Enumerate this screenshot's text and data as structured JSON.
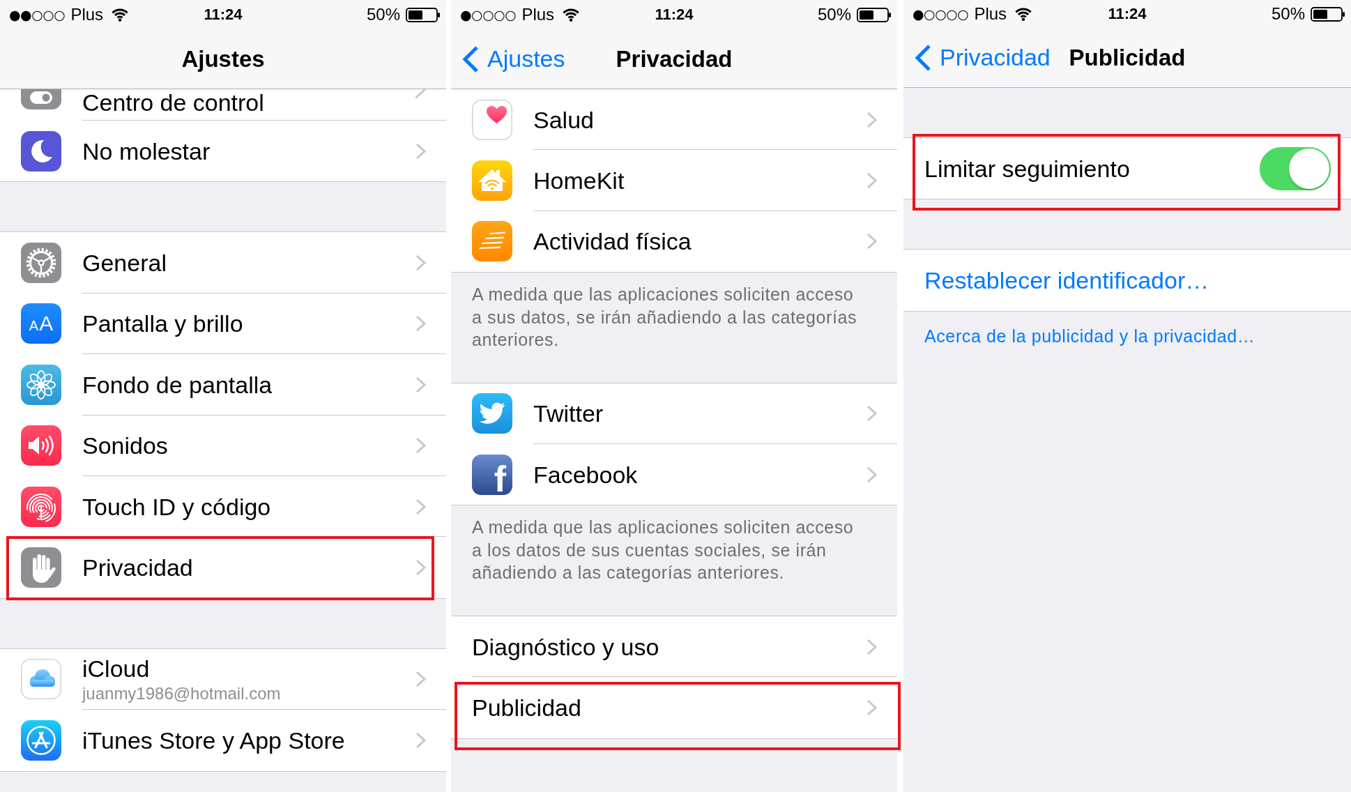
{
  "panels": [
    {
      "status_bar": {
        "signal": "●●○○○",
        "carrier": "Plus",
        "time": "11:24",
        "battery": "50%"
      },
      "nav_bar": {
        "title": "Ajustes"
      },
      "sections": [
        {
          "rows": [
            {
              "kind": "clipped",
              "label": "Centro de control",
              "highlighted": false
            },
            {
              "kind": "link",
              "label": "No molestar",
              "highlighted": false
            }
          ]
        },
        {
          "rows": [
            {
              "kind": "link",
              "label": "General",
              "highlighted": false
            },
            {
              "kind": "link",
              "label": "Pantalla y brillo",
              "icon_text": "AA",
              "highlighted": false
            },
            {
              "kind": "link",
              "label": "Fondo de pantalla",
              "highlighted": false
            },
            {
              "kind": "link",
              "label": "Sonidos",
              "highlighted": false
            },
            {
              "kind": "link",
              "label": "Touch ID y código",
              "highlighted": false
            },
            {
              "kind": "link",
              "label": "Privacidad",
              "highlighted": true
            }
          ]
        },
        {
          "rows": [
            {
              "kind": "link",
              "label": "iCloud",
              "subtitle": "juanmy1986@hotmail.com",
              "highlighted": false
            },
            {
              "kind": "link",
              "label": "iTunes Store y App Store",
              "highlighted": false
            }
          ]
        }
      ]
    },
    {
      "status_bar": {
        "signal": "●○○○○",
        "carrier": "Plus",
        "time": "11:24",
        "battery": "50%"
      },
      "nav_bar": {
        "back": "Ajustes",
        "title": "Privacidad"
      },
      "sections": [
        {
          "rows": [
            {
              "kind": "link",
              "label": "Salud",
              "highlighted": false
            },
            {
              "kind": "link",
              "label": "HomeKit",
              "highlighted": false
            },
            {
              "kind": "link",
              "label": "Actividad física",
              "highlighted": false
            }
          ],
          "footer": {
            "kind": "note",
            "text": "A medida que las aplicaciones soliciten acceso a sus datos, se irán añadiendo a las categorías anteriores."
          }
        },
        {
          "rows": [
            {
              "kind": "link",
              "label": "Twitter",
              "highlighted": false
            },
            {
              "kind": "link",
              "label": "Facebook",
              "icon_text": "f",
              "highlighted": false
            }
          ],
          "footer": {
            "kind": "note",
            "text": "A medida que las aplicaciones soliciten acceso a los datos de sus cuentas sociales, se irán añadiendo a las categorías anteriores."
          }
        },
        {
          "rows": [
            {
              "kind": "link",
              "label": "Diagnóstico y uso",
              "highlighted": false
            },
            {
              "kind": "link",
              "label": "Publicidad",
              "highlighted": true
            }
          ]
        }
      ]
    },
    {
      "status_bar": {
        "signal": "●○○○○",
        "carrier": "Plus",
        "time": "11:24",
        "battery": "50%"
      },
      "nav_bar": {
        "back": "Privacidad",
        "title": "Publicidad"
      },
      "sections": [
        {
          "rows": [
            {
              "kind": "toggle",
              "label": "Limitar seguimiento",
              "on": true,
              "highlighted": true
            }
          ]
        },
        {
          "rows": [
            {
              "kind": "action",
              "label": "Restablecer identificador…",
              "highlighted": false
            }
          ],
          "footer": {
            "kind": "link",
            "text": "Acerca de la publicidad y la privacidad…"
          }
        }
      ]
    }
  ]
}
